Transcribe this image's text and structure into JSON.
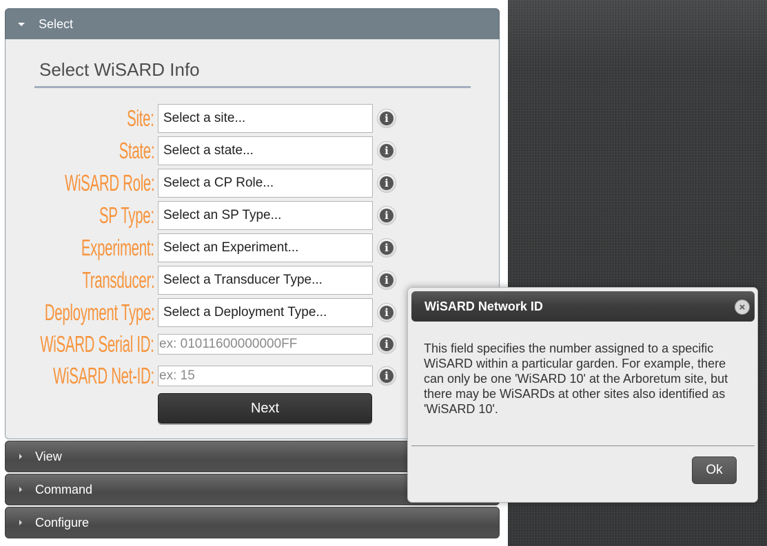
{
  "accordion": {
    "select_label": "Select",
    "view_label": "View",
    "command_label": "Command",
    "configure_label": "Configure"
  },
  "form": {
    "title": "Select WiSARD Info",
    "fields": [
      {
        "label": "Site:",
        "value": "Select a site..."
      },
      {
        "label": "State:",
        "value": "Select a state..."
      },
      {
        "label": "WiSARD Role:",
        "value": "Select a CP Role..."
      },
      {
        "label": "SP Type:",
        "value": "Select an SP Type..."
      },
      {
        "label": "Experiment:",
        "value": "Select an Experiment..."
      },
      {
        "label": "Transducer:",
        "value": "Select a Transducer Type..."
      },
      {
        "label": "Deployment Type:",
        "value": "Select a Deployment Type..."
      },
      {
        "label": "WiSARD Serial ID:",
        "placeholder": "ex: 01011600000000FF"
      },
      {
        "label": "WiSARD Net-ID:",
        "placeholder": "ex: 15"
      }
    ],
    "info_glyph": "i",
    "next_label": "Next"
  },
  "dialog": {
    "title": "WiSARD Network ID",
    "close_glyph": "×",
    "body": "This field specifies the number assigned to a specific WiSARD within a particular garden. For example, there can only be one 'WiSARD 10' at the Arboretum site, but there may be WiSARDs at other sites also identified as 'WiSARD 10'.",
    "ok_label": "Ok"
  },
  "colors": {
    "label_orange": "#f7943d",
    "select_header": "#72808a"
  }
}
